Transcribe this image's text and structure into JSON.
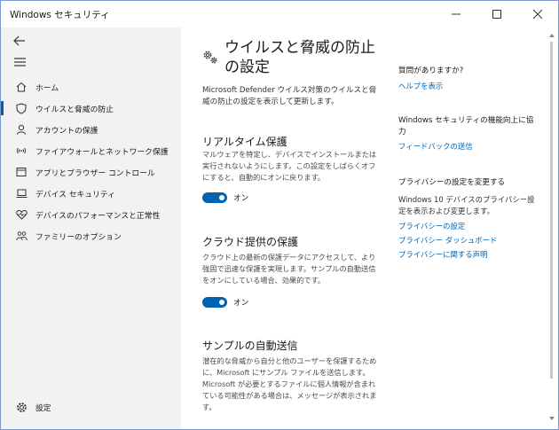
{
  "titlebar": {
    "title": "Windows セキュリティ",
    "minimize_icon": "minimize-icon",
    "maximize_icon": "maximize-icon",
    "close_icon": "close-icon"
  },
  "sidebar": {
    "back_icon": "back-arrow-icon",
    "menu_icon": "hamburger-menu-icon",
    "items": [
      {
        "label": "ホーム",
        "icon": "home-icon"
      },
      {
        "label": "ウイルスと脅威の防止",
        "icon": "shield-icon",
        "selected": true
      },
      {
        "label": "アカウントの保護",
        "icon": "person-icon"
      },
      {
        "label": "ファイアウォールとネットワーク保護",
        "icon": "wifi-icon"
      },
      {
        "label": "アプリとブラウザー コントロール",
        "icon": "app-browser-icon"
      },
      {
        "label": "デバイス セキュリティ",
        "icon": "laptop-icon"
      },
      {
        "label": "デバイスのパフォーマンスと正常性",
        "icon": "heart-pulse-icon"
      },
      {
        "label": "ファミリーのオプション",
        "icon": "family-icon"
      }
    ],
    "settings_label": "設定",
    "settings_icon": "gear-icon"
  },
  "main": {
    "title_icon": "gears-icon",
    "title": "ウイルスと脅威の防止の設定",
    "description": "Microsoft Defender ウイルス対策のウイルスと脅威の防止の設定を表示して更新します。",
    "sections": [
      {
        "title": "リアルタイム保護",
        "description": "マルウェアを特定し、デバイスでインストールまたは実行されないようにします。この設定をしばらくオフにすると、自動的にオンに戻ります。",
        "toggle": "オン"
      },
      {
        "title": "クラウド提供の保護",
        "description": "クラウド上の最新の保護データにアクセスして、より強固で迅速な保護を実現します。サンプルの自動送信をオンにしている場合、効果的です。",
        "toggle": "オン"
      },
      {
        "title": "サンプルの自動送信",
        "description": "潜在的な脅威から自分と他のユーザーを保護するために、Microsoft にサンプル ファイルを送信します。Microsoft が必要とするファイルに個人情報が含まれている可能性がある場合は、メッセージが表示されます。"
      }
    ]
  },
  "right_panel": {
    "questions_heading": "質問がありますか?",
    "help_link": "ヘルプを表示",
    "feedback_heading": "Windows セキュリティの機能向上に協力",
    "feedback_link": "フィードバックの送信",
    "privacy_heading": "プライバシーの設定を変更する",
    "privacy_text": "Windows 10 デバイスのプライバシー設定を表示および変更します。",
    "privacy_links": [
      "プライバシーの設定",
      "プライバシー ダッシュボード",
      "プライバシーに関する声明"
    ]
  },
  "colors": {
    "accent": "#0063b1",
    "sidebar_bg": "#f2f2f2",
    "window_border": "#7a9ccc"
  }
}
